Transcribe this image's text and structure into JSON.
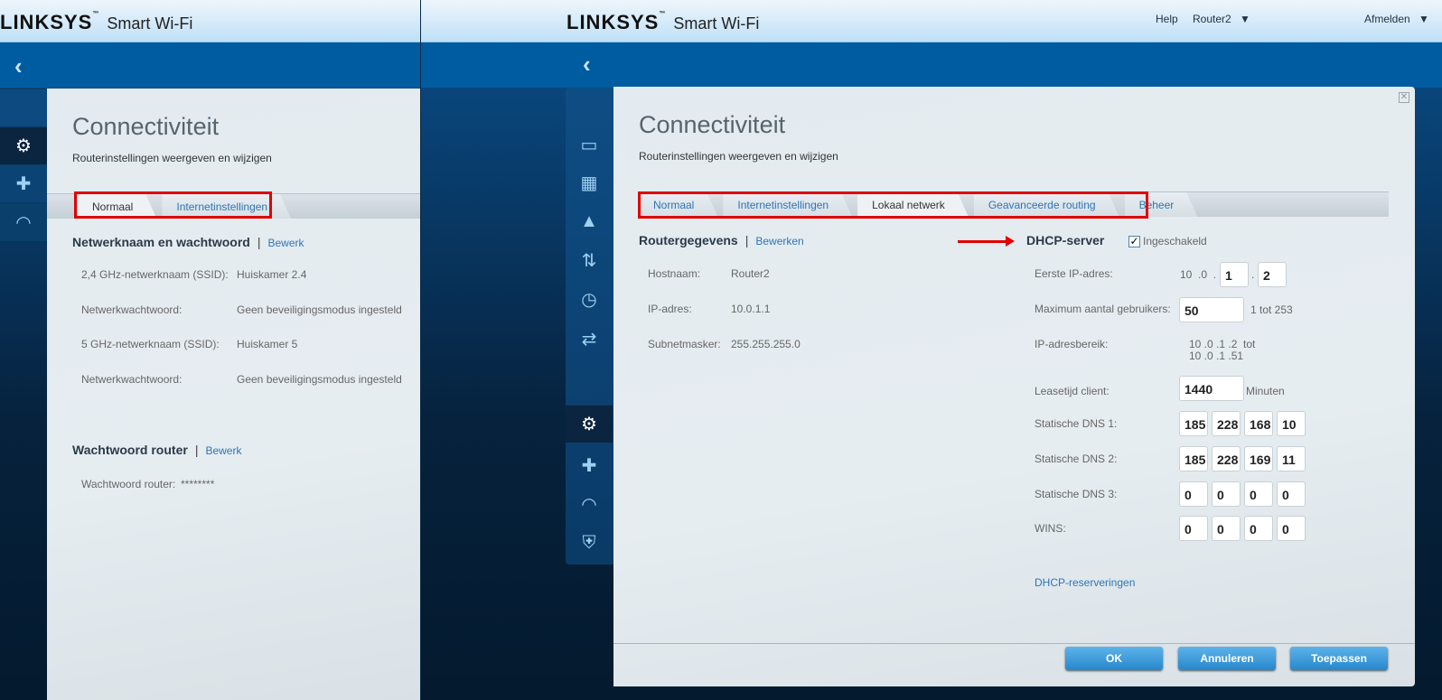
{
  "brand": {
    "logo": "LINKSYS",
    "tm": "™",
    "product": "Smart Wi-Fi"
  },
  "left": {
    "title": "Connectiviteit",
    "subtitle": "Routerinstellingen weergeven en wijzigen",
    "tabs": [
      {
        "label": "Normaal",
        "active": true
      },
      {
        "label": "Internetinstellingen",
        "active": false
      }
    ],
    "network_section": {
      "title": "Netwerknaam en wachtwoord",
      "edit": "Bewerk",
      "rows": [
        {
          "label": "2,4 GHz-netwerknaam (SSID):",
          "value": "Huiskamer 2.4"
        },
        {
          "label": "Netwerkwachtwoord:",
          "value": "Geen beveiligingsmodus ingesteld"
        },
        {
          "label": "5 GHz-netwerknaam (SSID):",
          "value": "Huiskamer 5"
        },
        {
          "label": "Netwerkwachtwoord:",
          "value": "Geen beveiligingsmodus ingesteld"
        }
      ]
    },
    "password_section": {
      "title": "Wachtwoord router",
      "edit": "Bewerk",
      "label": "Wachtwoord router:",
      "value": "********"
    }
  },
  "right": {
    "nav": {
      "help": "Help",
      "router": "Router2",
      "logout": "Afmelden"
    },
    "title": "Connectiviteit",
    "subtitle": "Routerinstellingen weergeven en wijzigen",
    "tabs": [
      {
        "label": "Normaal",
        "active": false
      },
      {
        "label": "Internetinstellingen",
        "active": false
      },
      {
        "label": "Lokaal netwerk",
        "active": true
      },
      {
        "label": "Geavanceerde routing",
        "active": false
      },
      {
        "label": "Beheer",
        "active": false
      }
    ],
    "router_section": {
      "title": "Routergegevens",
      "edit": "Bewerken",
      "rows": [
        {
          "label": "Hostnaam:",
          "value": "Router2"
        },
        {
          "label": "IP-adres:",
          "value": "10.0.1.1"
        },
        {
          "label": "Subnetmasker:",
          "value": "255.255.255.0"
        }
      ]
    },
    "dhcp": {
      "title": "DHCP-server",
      "enabled_label": "Ingeschakeld",
      "enabled": true,
      "first_ip_label": "Eerste IP-adres:",
      "first_ip_prefix": "10  .0  .",
      "first_ip_octets": [
        "1",
        "2"
      ],
      "dot": ".",
      "max_users_label": "Maximum aantal gebruikers:",
      "max_users": "50",
      "max_users_hint": "1 tot 253",
      "range_label": "IP-adresbereik:",
      "range_line1": "10 .0 .1 .2  tot",
      "range_line2": "10 .0 .1 .51",
      "lease_label": "Leasetijd client:",
      "lease": "1440",
      "lease_unit": "Minuten",
      "dns1_label": "Statische DNS 1:",
      "dns1": [
        "185",
        "228",
        "168",
        "10"
      ],
      "dns2_label": "Statische DNS 2:",
      "dns2": [
        "185",
        "228",
        "169",
        "11"
      ],
      "dns3_label": "Statische DNS 3:",
      "dns3": [
        "0",
        "0",
        "0",
        "0"
      ],
      "wins_label": "WINS:",
      "wins": [
        "0",
        "0",
        "0",
        "0"
      ],
      "reservations": "DHCP-reserveringen"
    },
    "buttons": {
      "ok": "OK",
      "cancel": "Annuleren",
      "apply": "Toepassen"
    }
  },
  "colors": {
    "accent": "#2f75b5",
    "band": "#005ca1",
    "highlight": "#e00000"
  }
}
